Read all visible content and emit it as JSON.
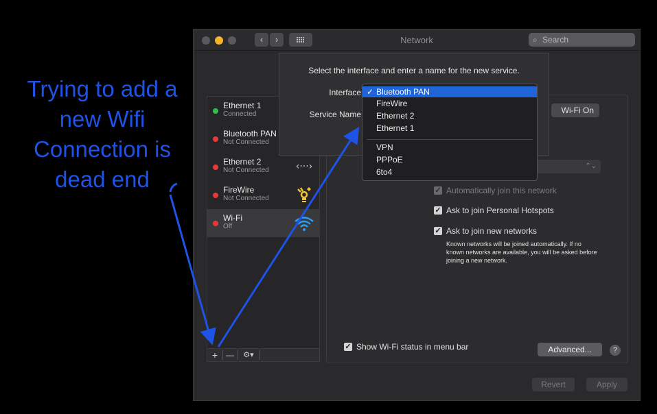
{
  "annotation": {
    "lines": [
      "Trying to add a",
      "new Wifi",
      "Connection is",
      "dead end"
    ],
    "color": "#1f52e6"
  },
  "window": {
    "title": "Network",
    "search_placeholder": "Search",
    "traffic_lights": [
      "#5a5a5e",
      "#f5b429",
      "#5a5a5e"
    ]
  },
  "sidebar": {
    "services": [
      {
        "name": "Ethernet 1",
        "status": "Connected",
        "dot": "#2ec14a",
        "icon": "ethernet-icon"
      },
      {
        "name": "Bluetooth PAN",
        "status": "Not Connected",
        "dot": "#e8383a",
        "icon": "bluetooth-icon"
      },
      {
        "name": "Ethernet 2",
        "status": "Not Connected",
        "dot": "#e8383a",
        "icon": "ethernet-icon"
      },
      {
        "name": "FireWire",
        "status": "Not Connected",
        "dot": "#e8383a",
        "icon": "firewire-icon"
      },
      {
        "name": "Wi-Fi",
        "status": "Off",
        "dot": "#e8383a",
        "icon": "wifi-icon"
      }
    ],
    "add_label": "+",
    "remove_label": "—",
    "action_label": "⚙▾"
  },
  "panel": {
    "wifi_on_label": "Wi-Fi On",
    "checkboxes": [
      {
        "label": "Automatically join this network",
        "checked": true,
        "enabled": false
      },
      {
        "label": "Ask to join Personal Hotspots",
        "checked": true,
        "enabled": true
      },
      {
        "label": "Ask to join new networks",
        "checked": true,
        "enabled": true
      }
    ],
    "note": "Known networks will be joined automatically. If no known networks are available, you will be asked before joining a new network.",
    "show_status_label": "Show Wi-Fi status in menu bar",
    "advanced_label": "Advanced...",
    "help_label": "?",
    "revert_label": "Revert",
    "apply_label": "Apply"
  },
  "sheet": {
    "prompt": "Select the interface and enter a name for the new service.",
    "interface_label": "Interface",
    "service_name_label": "Service Name",
    "menu": {
      "selected": "Bluetooth PAN",
      "items": [
        "Bluetooth PAN",
        "FireWire",
        "Ethernet 2",
        "Ethernet 1",
        "VPN",
        "PPPoE",
        "6to4"
      ]
    }
  }
}
